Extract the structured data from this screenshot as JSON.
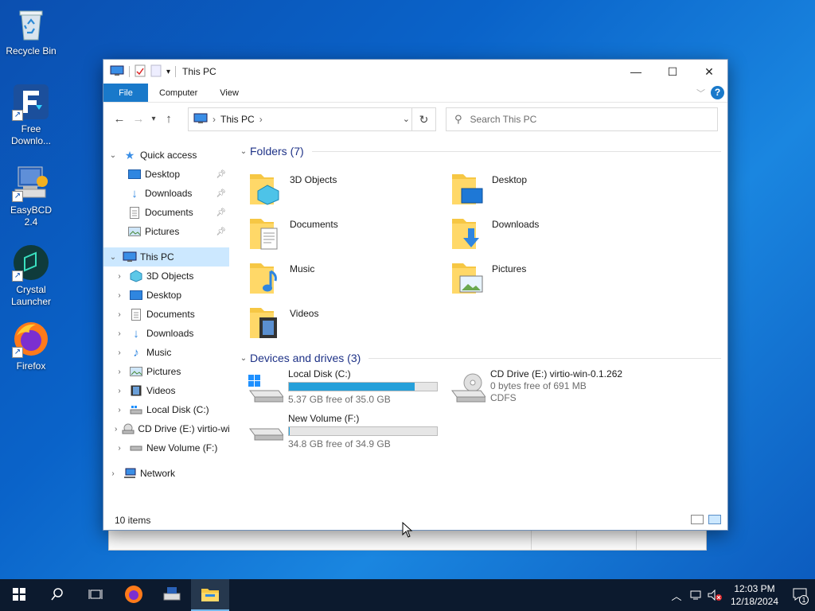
{
  "desktop": {
    "icons": [
      {
        "label": "Recycle Bin",
        "icon": "recycle-bin-icon"
      },
      {
        "label": "Free Downlo...",
        "icon": "free-download-manager-icon"
      },
      {
        "label": "EasyBCD 2.4",
        "icon": "easybcd-icon"
      },
      {
        "label": "Crystal Launcher",
        "icon": "crystal-launcher-icon"
      },
      {
        "label": "Firefox",
        "icon": "firefox-icon"
      }
    ]
  },
  "window": {
    "title": "This PC",
    "ribbon_tabs": [
      "File",
      "Computer",
      "View"
    ],
    "address": {
      "crumb": "This PC"
    },
    "search": {
      "placeholder": "Search This PC"
    },
    "navpane": {
      "quick_access": {
        "label": "Quick access",
        "items": [
          {
            "label": "Desktop",
            "pinned": true
          },
          {
            "label": "Downloads",
            "pinned": true
          },
          {
            "label": "Documents",
            "pinned": true
          },
          {
            "label": "Pictures",
            "pinned": true
          }
        ]
      },
      "this_pc": {
        "label": "This PC",
        "items": [
          {
            "label": "3D Objects"
          },
          {
            "label": "Desktop"
          },
          {
            "label": "Documents"
          },
          {
            "label": "Downloads"
          },
          {
            "label": "Music"
          },
          {
            "label": "Pictures"
          },
          {
            "label": "Videos"
          },
          {
            "label": "Local Disk (C:)"
          },
          {
            "label": "CD Drive (E:) virtio-win-0.1.262"
          },
          {
            "label": "New Volume (F:)"
          }
        ]
      },
      "network": {
        "label": "Network"
      }
    },
    "folders_group": {
      "header": "Folders (7)",
      "items": [
        {
          "label": "3D Objects",
          "icon": "3d-objects-folder-icon"
        },
        {
          "label": "Desktop",
          "icon": "desktop-folder-icon"
        },
        {
          "label": "Documents",
          "icon": "documents-folder-icon"
        },
        {
          "label": "Downloads",
          "icon": "downloads-folder-icon"
        },
        {
          "label": "Music",
          "icon": "music-folder-icon"
        },
        {
          "label": "Pictures",
          "icon": "pictures-folder-icon"
        },
        {
          "label": "Videos",
          "icon": "videos-folder-icon"
        }
      ]
    },
    "drives_group": {
      "header": "Devices and drives (3)",
      "items": [
        {
          "name": "Local Disk (C:)",
          "free_text": "5.37 GB free of 35.0 GB",
          "used_fraction": 0.85,
          "bar_color": "#26a0da"
        },
        {
          "name": "CD Drive (E:) virtio-win-0.1.262",
          "free_text": "0 bytes free of 691 MB",
          "fs": "CDFS"
        },
        {
          "name": "New Volume (F:)",
          "free_text": "34.8 GB free of 34.9 GB",
          "used_fraction": 0.003,
          "bar_color": "#26a0da"
        }
      ]
    },
    "status": {
      "items_count": "10 items"
    }
  },
  "taskbar": {
    "clock_time": "12:03 PM",
    "clock_date": "12/18/2024",
    "notification_count": "1"
  },
  "colors": {
    "accent": "#1979ca",
    "selection": "#cce8ff",
    "taskbar": "#0c1a2e"
  }
}
